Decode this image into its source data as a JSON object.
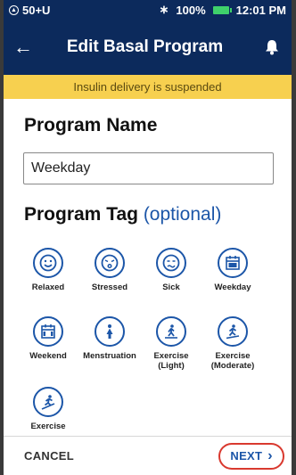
{
  "status_bar": {
    "pod_label": "50+U",
    "battery": "100%",
    "time": "12:01 PM"
  },
  "header": {
    "title": "Edit Basal Program",
    "back_icon": "arrow-left-icon",
    "bell_icon": "bell-icon"
  },
  "banner": {
    "text": "Insulin delivery is suspended"
  },
  "program_name": {
    "label": "Program Name",
    "value": "Weekday"
  },
  "program_tag": {
    "label": "Program Tag",
    "optional": "(optional)",
    "tags": [
      {
        "label": "Relaxed",
        "icon": "relaxed-face-icon"
      },
      {
        "label": "Stressed",
        "icon": "stressed-face-icon"
      },
      {
        "label": "Sick",
        "icon": "sick-face-icon"
      },
      {
        "label": "Weekday",
        "icon": "calendar-weekday-icon"
      },
      {
        "label": "Weekend",
        "icon": "calendar-weekend-icon"
      },
      {
        "label": "Menstruation",
        "icon": "menstruation-icon"
      },
      {
        "label": "Exercise\n(Light)",
        "icon": "exercise-light-icon"
      },
      {
        "label": "Exercise\n(Moderate)",
        "icon": "exercise-moderate-icon"
      },
      {
        "label": "Exercise",
        "icon": "exercise-intense-icon"
      }
    ]
  },
  "footer": {
    "cancel_label": "CANCEL",
    "next_label": "NEXT"
  },
  "colors": {
    "header_bg": "#0c2a5c",
    "banner_bg": "#f7d04f",
    "accent": "#1c56a8",
    "highlight": "#d9392f"
  }
}
